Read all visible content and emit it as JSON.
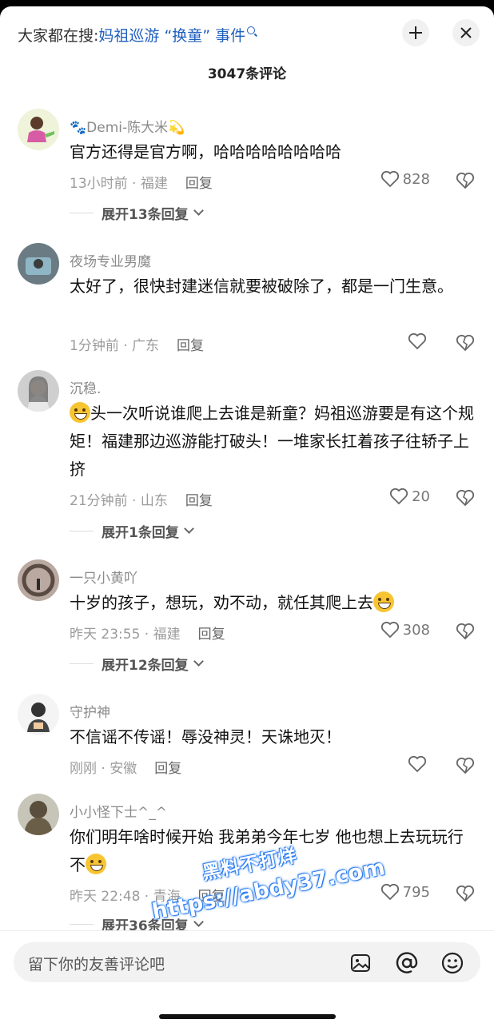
{
  "header": {
    "search_label": "大家都在搜:",
    "search_query": "妈祖巡游 “换童” 事件",
    "comment_count": "3047条评论"
  },
  "comments": [
    {
      "username": "🐾Demi-陈大米💫",
      "text": "官方还得是官方啊，哈哈哈哈哈哈哈哈",
      "time_location": "13小时前 · 福建",
      "reply_label": "回复",
      "likes": "828",
      "expand_label": "展开13条回复"
    },
    {
      "username": "夜场专业男魔",
      "text": "太好了，很快封建迷信就要被破除了，都是一门生意。",
      "time_location": "1分钟前 · 广东",
      "reply_label": "回复",
      "likes": ""
    },
    {
      "username": "沉稳.",
      "text": "头一次听说谁爬上去谁是新童？妈祖巡游要是有这个规矩！福建那边巡游能打破头！一堆家长扛着孩子往轿子上挤",
      "time_location": "21分钟前 · 山东",
      "reply_label": "回复",
      "likes": "20",
      "expand_label": "展开1条回复"
    },
    {
      "username": "一只小黄吖",
      "text": "十岁的孩子，想玩，劝不动，就任其爬上去",
      "time_location": "昨天 23:55 · 福建",
      "reply_label": "回复",
      "likes": "308",
      "expand_label": "展开12条回复"
    },
    {
      "username": "守护神",
      "text": "不信谣不传谣！辱没神灵！天诛地灭！",
      "time_location": "刚刚 · 安徽",
      "reply_label": "回复",
      "likes": ""
    },
    {
      "username": "小小怪下士^_^",
      "text": "你们明年啥时候开始  我弟弟今年七岁  他也想上去玩玩行不",
      "time_location": "昨天 22:48 · 青海",
      "reply_label": "回复",
      "likes": "795",
      "expand_label": "展开36条回复"
    }
  ],
  "watermark": {
    "line1": "黑料不打烊",
    "line2": "https://abdy37.com"
  },
  "input": {
    "placeholder": "留下你的友善评论吧"
  },
  "icons": [
    "collapse-icon",
    "close-icon",
    "heart-icon",
    "broken-heart-icon",
    "image-icon",
    "at-icon",
    "emoji-icon",
    "search-icon"
  ],
  "colors": {
    "link_blue": "#1f5fbf",
    "watermark_blue": "#2a7cf0"
  }
}
